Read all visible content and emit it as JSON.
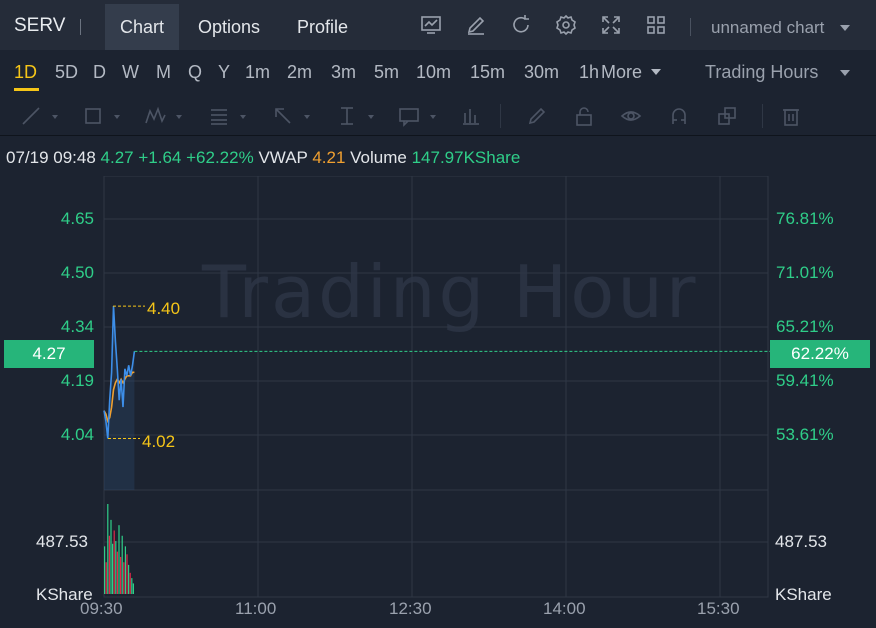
{
  "header": {
    "ticker": "SERV",
    "tabs": [
      {
        "label": "Chart",
        "active": true
      },
      {
        "label": "Options",
        "active": false
      },
      {
        "label": "Profile",
        "active": false
      }
    ],
    "tool_icons": [
      "indicator-icon",
      "draw-pen-icon",
      "refresh-icon",
      "settings-gear-icon",
      "fullscreen-icon",
      "layout-grid-icon"
    ],
    "chart_name": "unnamed chart"
  },
  "intervals": {
    "items": [
      "1D",
      "5D",
      "D",
      "W",
      "M",
      "Q",
      "Y",
      "1m",
      "2m",
      "3m",
      "5m",
      "10m",
      "15m",
      "30m",
      "1h"
    ],
    "active": "1D",
    "more_label": "More",
    "session_label": "Trading Hours"
  },
  "drawing_tools": [
    "trend-line-icon",
    "rectangle-icon",
    "pattern-icon",
    "fibonacci-icon",
    "arrow-icon",
    "price-range-icon",
    "text-note-icon",
    "measure-icon",
    "brush-icon",
    "lock-icon",
    "visibility-eye-icon",
    "magnet-icon",
    "clone-icon",
    "trash-icon"
  ],
  "quote": {
    "datetime": "07/19 09:48",
    "price": "4.27",
    "change": "+1.64",
    "change_pct": "+62.22%",
    "vwap_label": "VWAP",
    "vwap_value": "4.21",
    "volume_label": "Volume",
    "volume_value": "147.97KShare"
  },
  "chart": {
    "watermark": "Trading Hour",
    "price_axis": [
      "4.65",
      "4.50",
      "4.34",
      "4.19",
      "4.04"
    ],
    "pct_axis": [
      "76.81%",
      "71.01%",
      "65.21%",
      "59.41%",
      "53.61%"
    ],
    "current_price_tag": "4.27",
    "current_pct_tag": "62.22%",
    "high_label": "4.40",
    "low_label": "4.02",
    "volume_axis_value": "487.53",
    "volume_unit": "KShare",
    "time_axis": [
      "09:30",
      "11:00",
      "12:30",
      "14:00",
      "15:30"
    ],
    "colors": {
      "up": "#2fce89",
      "down": "#e0294a",
      "price_line": "#3d8ee8",
      "vwap_line": "#f0a030",
      "highlow": "#f5c518"
    }
  },
  "chart_data": {
    "type": "line",
    "x_range": [
      "09:30",
      "16:00"
    ],
    "price_range": [
      3.96,
      4.72
    ],
    "series": [
      {
        "name": "",
        "values": [
          4.1,
          4.07,
          4.02,
          4.13,
          4.21,
          4.4,
          4.3,
          4.22,
          4.13,
          4.19,
          4.11,
          4.22,
          4.2,
          4.23,
          4.2,
          4.23,
          4.27
        ]
      },
      {
        "name": "VWAP",
        "values": [
          4.1,
          4.09,
          4.07,
          4.08,
          4.11,
          4.16,
          4.18,
          4.19,
          4.18,
          4.19,
          4.18,
          4.19,
          4.2,
          4.2,
          4.2,
          4.21,
          4.21
        ]
      }
    ],
    "volume": [
      90,
      60,
      170,
      110,
      140,
      95,
      120,
      100,
      80,
      130,
      70,
      110,
      60,
      90,
      75,
      55,
      40,
      30,
      20
    ],
    "volume_up": [
      true,
      false,
      true,
      false,
      true,
      true,
      false,
      true,
      false,
      true,
      false,
      true,
      false,
      true,
      false,
      true,
      false,
      true,
      true
    ],
    "high": 4.4,
    "low": 4.02,
    "last": 4.27
  }
}
